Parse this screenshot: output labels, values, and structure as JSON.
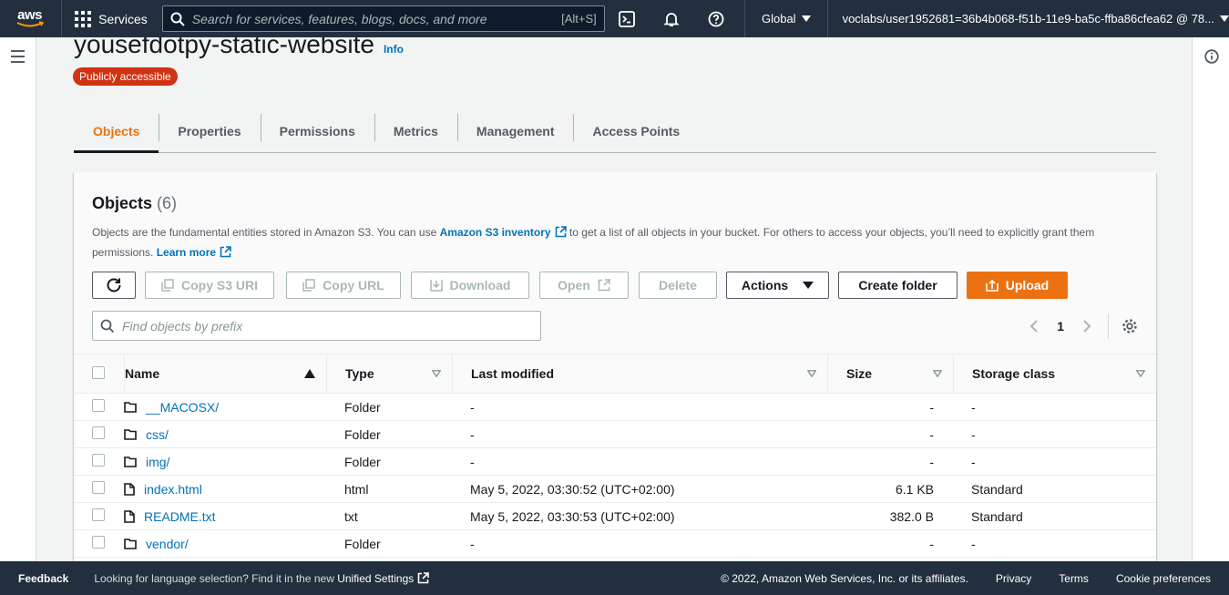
{
  "nav": {
    "logo": "aws",
    "services": "Services",
    "search_placeholder": "Search for services, features, blogs, docs, and more",
    "search_shortcut": "[Alt+S]",
    "region": "Global",
    "account": "voclabs/user1952681=36b4b068-f51b-11e9-ba5c-ffba86cfea62 @ 78..."
  },
  "page": {
    "title": "yousefdotpy-static-website",
    "info": "Info",
    "badge": "Publicly accessible"
  },
  "tabs": [
    "Objects",
    "Properties",
    "Permissions",
    "Metrics",
    "Management",
    "Access Points"
  ],
  "objects": {
    "title": "Objects",
    "count": "(6)",
    "desc_1": "Objects are the fundamental entities stored in Amazon S3. You can use ",
    "desc_link": "Amazon S3 inventory",
    "desc_2": " to get a list of all objects in your bucket. For others to access your objects, you’ll need to explicitly grant them permissions. ",
    "learn_more": "Learn more",
    "buttons": {
      "copy_uri": "Copy S3 URI",
      "copy_url": "Copy URL",
      "download": "Download",
      "open": "Open",
      "delete": "Delete",
      "actions": "Actions",
      "create_folder": "Create folder",
      "upload": "Upload"
    },
    "filter_placeholder": "Find objects by prefix",
    "page_number": "1",
    "columns": [
      "Name",
      "Type",
      "Last modified",
      "Size",
      "Storage class"
    ],
    "rows": [
      {
        "name": "__MACOSX/",
        "kind": "folder",
        "type": "Folder",
        "modified": "-",
        "size": "-",
        "storage": "-"
      },
      {
        "name": "css/",
        "kind": "folder",
        "type": "Folder",
        "modified": "-",
        "size": "-",
        "storage": "-"
      },
      {
        "name": "img/",
        "kind": "folder",
        "type": "Folder",
        "modified": "-",
        "size": "-",
        "storage": "-"
      },
      {
        "name": "index.html",
        "kind": "file",
        "type": "html",
        "modified": "May 5, 2022, 03:30:52 (UTC+02:00)",
        "size": "6.1 KB",
        "storage": "Standard"
      },
      {
        "name": "README.txt",
        "kind": "file",
        "type": "txt",
        "modified": "May 5, 2022, 03:30:53 (UTC+02:00)",
        "size": "382.0 B",
        "storage": "Standard"
      },
      {
        "name": "vendor/",
        "kind": "folder",
        "type": "Folder",
        "modified": "-",
        "size": "-",
        "storage": "-"
      }
    ]
  },
  "footer": {
    "feedback": "Feedback",
    "lang_text": "Looking for language selection? Find it in the new ",
    "lang_link": "Unified Settings",
    "copyright": "© 2022, Amazon Web Services, Inc. or its affiliates.",
    "privacy": "Privacy",
    "terms": "Terms",
    "cookies": "Cookie preferences"
  },
  "colors": {
    "nav_bg": "#232f3e",
    "accent": "#ec7211",
    "link": "#0073bb",
    "badge": "#d13212"
  }
}
